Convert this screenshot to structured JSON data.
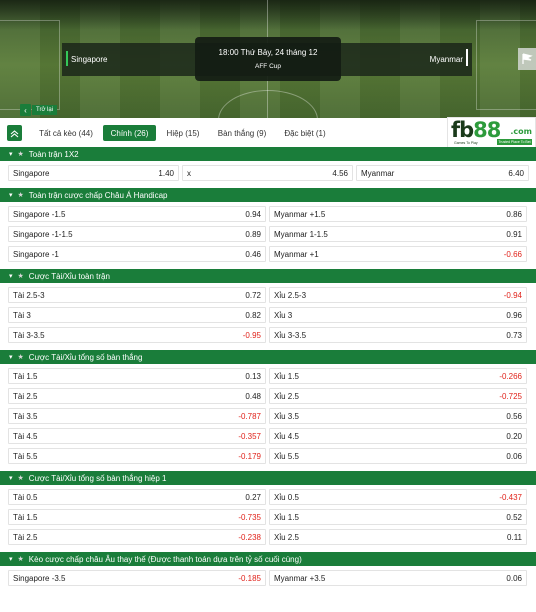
{
  "match": {
    "home": "Singapore",
    "away": "Myanmar",
    "datetime": "18:00 Thứ Bảy, 24 tháng 12",
    "competition": "AFF Cup"
  },
  "back_label": "Trở lại",
  "tabs": [
    {
      "label": "Tất cả kèo (44)",
      "active": false
    },
    {
      "label": "Chính (26)",
      "active": true
    },
    {
      "label": "Hiệp (15)",
      "active": false
    },
    {
      "label": "Bàn thắng (9)",
      "active": false
    },
    {
      "label": "Đặc biệt (1)",
      "active": false
    }
  ],
  "logo": {
    "name_a": "fb",
    "name_b": "88",
    "domain": ".com",
    "tagline": "Games To Play",
    "tagline2": "Trusted Place To Bet"
  },
  "colors": {
    "brand_green": "#1a7d3a",
    "negative_red": "#e0231b"
  },
  "sections": [
    {
      "title": "Toàn trận 1X2",
      "layout": "three",
      "rows": [
        [
          {
            "label": "Singapore",
            "odd": "1.40"
          },
          {
            "label": "x",
            "odd": "4.56"
          },
          {
            "label": "Myanmar",
            "odd": "6.40"
          }
        ]
      ]
    },
    {
      "title": "Toàn trận cược chấp Châu Á Handicap",
      "layout": "two",
      "rows": [
        [
          {
            "label": "Singapore -1.5",
            "odd": "0.94"
          },
          {
            "label": "Myanmar +1.5",
            "odd": "0.86"
          }
        ],
        [
          {
            "label": "Singapore -1-1.5",
            "odd": "0.89"
          },
          {
            "label": "Myanmar 1-1.5",
            "odd": "0.91"
          }
        ],
        [
          {
            "label": "Singapore -1",
            "odd": "0.46"
          },
          {
            "label": "Myanmar +1",
            "odd": "-0.66"
          }
        ]
      ]
    },
    {
      "title": "Cược Tài/Xỉu toàn trận",
      "layout": "two",
      "rows": [
        [
          {
            "label": "Tài 2.5-3",
            "odd": "0.72"
          },
          {
            "label": "Xỉu 2.5-3",
            "odd": "-0.94"
          }
        ],
        [
          {
            "label": "Tài 3",
            "odd": "0.82"
          },
          {
            "label": "Xỉu 3",
            "odd": "0.96"
          }
        ],
        [
          {
            "label": "Tài 3-3.5",
            "odd": "-0.95"
          },
          {
            "label": "Xỉu 3-3.5",
            "odd": "0.73"
          }
        ]
      ]
    },
    {
      "title": "Cược Tài/Xỉu tổng số bàn thắng",
      "layout": "two",
      "rows": [
        [
          {
            "label": "Tài 1.5",
            "odd": "0.13"
          },
          {
            "label": "Xỉu 1.5",
            "odd": "-0.266"
          }
        ],
        [
          {
            "label": "Tài 2.5",
            "odd": "0.48"
          },
          {
            "label": "Xỉu 2.5",
            "odd": "-0.725"
          }
        ],
        [
          {
            "label": "Tài 3.5",
            "odd": "-0.787"
          },
          {
            "label": "Xỉu 3.5",
            "odd": "0.56"
          }
        ],
        [
          {
            "label": "Tài 4.5",
            "odd": "-0.357"
          },
          {
            "label": "Xỉu 4.5",
            "odd": "0.20"
          }
        ],
        [
          {
            "label": "Tài 5.5",
            "odd": "-0.179"
          },
          {
            "label": "Xỉu 5.5",
            "odd": "0.06"
          }
        ]
      ]
    },
    {
      "title": "Cược Tài/Xỉu tổng số bàn thắng hiệp 1",
      "layout": "two",
      "rows": [
        [
          {
            "label": "Tài 0.5",
            "odd": "0.27"
          },
          {
            "label": "Xỉu 0.5",
            "odd": "-0.437"
          }
        ],
        [
          {
            "label": "Tài 1.5",
            "odd": "-0.735"
          },
          {
            "label": "Xỉu 1.5",
            "odd": "0.52"
          }
        ],
        [
          {
            "label": "Tài 2.5",
            "odd": "-0.238"
          },
          {
            "label": "Xỉu 2.5",
            "odd": "0.11"
          }
        ]
      ]
    },
    {
      "title": "Kèo cược chấp châu Âu thay thế (Được thanh toán dựa trên tỷ số cuối cùng)",
      "layout": "two",
      "rows": [
        [
          {
            "label": "Singapore -3.5",
            "odd": "-0.185"
          },
          {
            "label": "Myanmar +3.5",
            "odd": "0.06"
          }
        ]
      ]
    }
  ]
}
